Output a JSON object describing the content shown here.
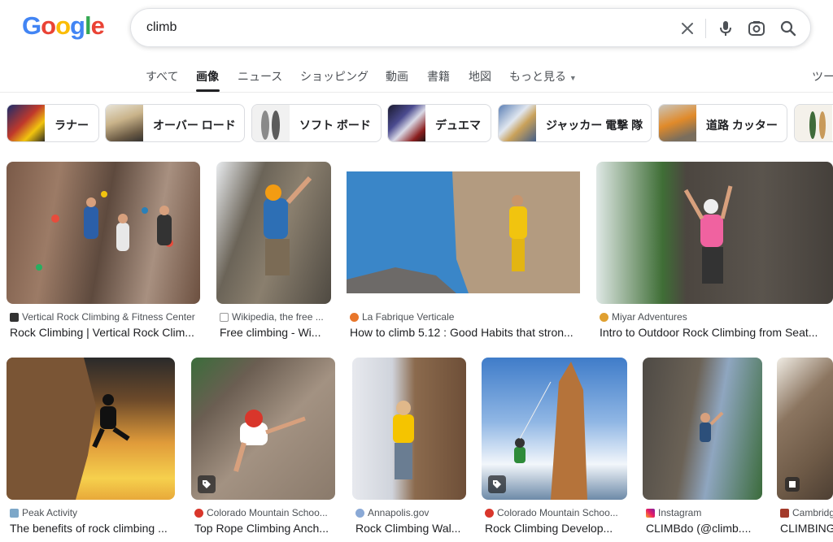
{
  "logo": {
    "letters": [
      "G",
      "o",
      "o",
      "g",
      "l",
      "e"
    ],
    "colors": [
      "#4285F4",
      "#EA4335",
      "#FBBC05",
      "#4285F4",
      "#34A853",
      "#EA4335"
    ]
  },
  "search": {
    "query": "climb"
  },
  "icons": {
    "clear": "close-icon",
    "voice": "mic-icon",
    "lens": "lens-icon",
    "search": "search-icon"
  },
  "tabs": [
    {
      "label": "すべて"
    },
    {
      "label": "画像"
    },
    {
      "label": "ニュース"
    },
    {
      "label": "ショッピング"
    },
    {
      "label": "動画"
    },
    {
      "label": "書籍"
    },
    {
      "label": "地図"
    },
    {
      "label": "もっと見る"
    },
    {
      "label": "ツー"
    }
  ],
  "chips": [
    {
      "label": "ラナー"
    },
    {
      "label": "オーバー ロード"
    },
    {
      "label": "ソフト ボード"
    },
    {
      "label": "デュエマ"
    },
    {
      "label": "ジャッカー 電撃 隊"
    },
    {
      "label": "道路 カッター"
    }
  ],
  "results_row1": [
    {
      "source": "Vertical Rock Climbing & Fitness Center",
      "title": "Rock Climbing | Vertical Rock Clim..."
    },
    {
      "source": "Wikipedia, the free ...",
      "title": "Free climbing - Wi..."
    },
    {
      "source": "La Fabrique Verticale",
      "title": "How to climb 5.12 : Good Habits that stron..."
    },
    {
      "source": "Miyar Adventures",
      "title": "Intro to Outdoor Rock Climbing from Seat..."
    }
  ],
  "results_row2": [
    {
      "source": "Peak Activity",
      "title": "The benefits of rock climbing ..."
    },
    {
      "source": "Colorado Mountain Schoo...",
      "title": "Top Rope Climbing Anch..."
    },
    {
      "source": "Annapolis.gov",
      "title": "Rock Climbing Wal..."
    },
    {
      "source": "Colorado Mountain Schoo...",
      "title": "Rock Climbing Develop..."
    },
    {
      "source": "Instagram",
      "title": "CLIMBdo (@climb...."
    },
    {
      "source": "Cambridge",
      "title": "CLIMBING"
    }
  ]
}
